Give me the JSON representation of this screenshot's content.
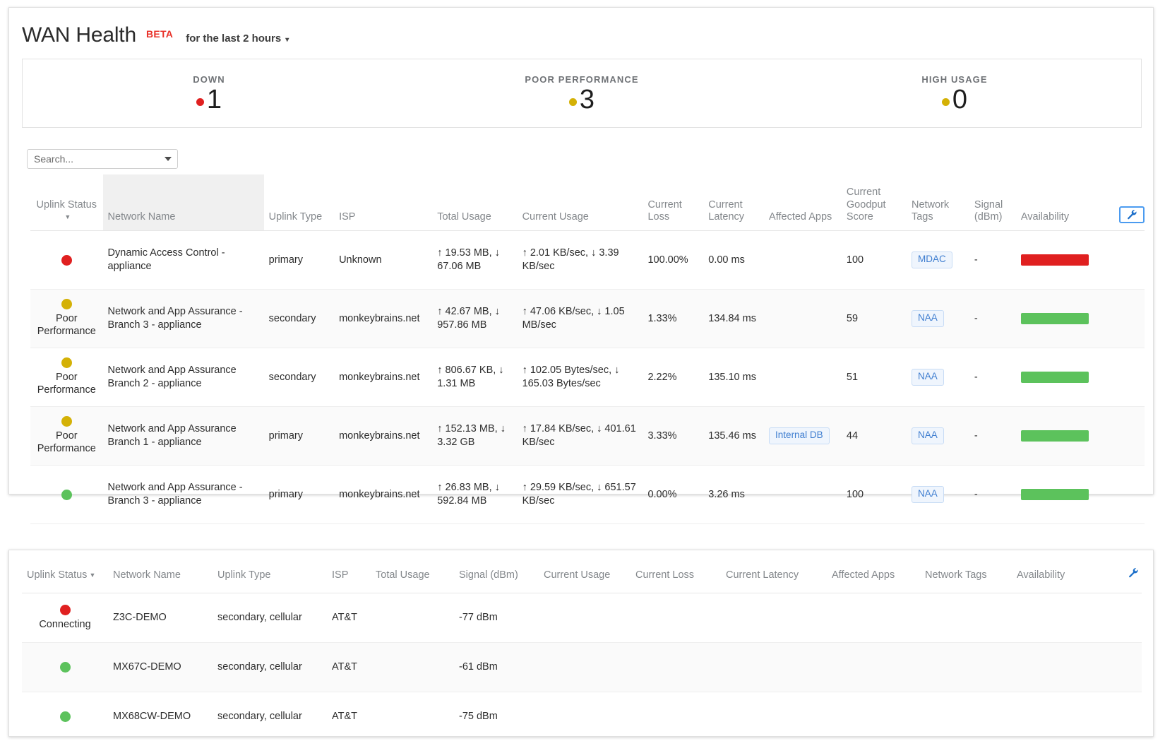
{
  "header": {
    "title": "WAN Health",
    "beta": "BETA",
    "time_range": "for the last 2 hours",
    "caret": "▾"
  },
  "summary": {
    "cards": [
      {
        "label": "DOWN",
        "value": "1",
        "color": "#e02020"
      },
      {
        "label": "POOR PERFORMANCE",
        "value": "3",
        "color": "#d4b106"
      },
      {
        "label": "HIGH USAGE",
        "value": "0",
        "color": "#d4b106"
      }
    ]
  },
  "search": {
    "placeholder": "Search...",
    "value": ""
  },
  "table1": {
    "columns": [
      "Uplink Status",
      "Network Name",
      "Uplink Type",
      "ISP",
      "Total Usage",
      "Current Usage",
      "Current Loss",
      "Current Latency",
      "Affected Apps",
      "Current Goodput Score",
      "Network Tags",
      "Signal (dBm)",
      "Availability"
    ],
    "sort_column": "Uplink Status",
    "rows": [
      {
        "status_color": "#e02020",
        "status_text": "",
        "network_name": "Dynamic Access Control - appliance",
        "uplink_type": "primary",
        "isp": "Unknown",
        "total_usage": "↑ 19.53 MB, ↓ 67.06 MB",
        "current_usage": "↑ 2.01 KB/sec, ↓ 3.39 KB/sec",
        "current_loss": "100.00%",
        "current_latency": "0.00 ms",
        "affected_apps": "",
        "goodput_score": "100",
        "network_tags": "MDAC",
        "signal": "-",
        "availability_color": "#e02020"
      },
      {
        "status_color": "#d4b106",
        "status_text": "Poor Performance",
        "network_name": "Network and App Assurance - Branch 3 - appliance",
        "uplink_type": "secondary",
        "isp": "monkeybrains.net",
        "total_usage": "↑ 42.67 MB, ↓ 957.86 MB",
        "current_usage": "↑ 47.06 KB/sec, ↓ 1.05 MB/sec",
        "current_loss": "1.33%",
        "current_latency": "134.84 ms",
        "affected_apps": "",
        "goodput_score": "59",
        "network_tags": "NAA",
        "signal": "-",
        "availability_color": "#5cc25c"
      },
      {
        "status_color": "#d4b106",
        "status_text": "Poor Performance",
        "network_name": "Network and App Assurance Branch 2 - appliance",
        "uplink_type": "secondary",
        "isp": "monkeybrains.net",
        "total_usage": "↑ 806.67 KB, ↓ 1.31 MB",
        "current_usage": "↑ 102.05 Bytes/sec, ↓ 165.03 Bytes/sec",
        "current_loss": "2.22%",
        "current_latency": "135.10 ms",
        "affected_apps": "",
        "goodput_score": "51",
        "network_tags": "NAA",
        "signal": "-",
        "availability_color": "#5cc25c"
      },
      {
        "status_color": "#d4b106",
        "status_text": "Poor Performance",
        "network_name": "Network and App Assurance Branch 1 - appliance",
        "uplink_type": "primary",
        "isp": "monkeybrains.net",
        "total_usage": "↑ 152.13 MB, ↓ 3.32 GB",
        "current_usage": "↑ 17.84 KB/sec, ↓ 401.61 KB/sec",
        "current_loss": "3.33%",
        "current_latency": "135.46 ms",
        "affected_apps": "Internal DB",
        "goodput_score": "44",
        "network_tags": "NAA",
        "signal": "-",
        "availability_color": "#5cc25c"
      },
      {
        "status_color": "#5cc25c",
        "status_text": "",
        "network_name": "Network and App Assurance - Branch 3 - appliance",
        "uplink_type": "primary",
        "isp": "monkeybrains.net",
        "total_usage": "↑ 26.83 MB, ↓ 592.84 MB",
        "current_usage": "↑ 29.59 KB/sec, ↓ 651.57 KB/sec",
        "current_loss": "0.00%",
        "current_latency": "3.26 ms",
        "affected_apps": "",
        "goodput_score": "100",
        "network_tags": "NAA",
        "signal": "-",
        "availability_color": "#5cc25c"
      }
    ]
  },
  "table2": {
    "columns": [
      "Uplink Status",
      "Network Name",
      "Uplink Type",
      "ISP",
      "Total Usage",
      "Signal (dBm)",
      "Current Usage",
      "Current Loss",
      "Current Latency",
      "Affected Apps",
      "Network Tags",
      "Availability"
    ],
    "sort_column": "Uplink Status",
    "rows": [
      {
        "status_color": "#e02020",
        "status_text": "Connecting",
        "network_name": "Z3C-DEMO",
        "uplink_type": "secondary, cellular",
        "isp": "AT&T",
        "total_usage": "",
        "signal": "-77 dBm",
        "current_usage": "",
        "current_loss": "",
        "current_latency": "",
        "affected_apps": "",
        "network_tags": "",
        "availability": ""
      },
      {
        "status_color": "#5cc25c",
        "status_text": "",
        "network_name": "MX67C-DEMO",
        "uplink_type": "secondary, cellular",
        "isp": "AT&T",
        "total_usage": "",
        "signal": "-61 dBm",
        "current_usage": "",
        "current_loss": "",
        "current_latency": "",
        "affected_apps": "",
        "network_tags": "",
        "availability": ""
      },
      {
        "status_color": "#5cc25c",
        "status_text": "",
        "network_name": "MX68CW-DEMO",
        "uplink_type": "secondary, cellular",
        "isp": "AT&T",
        "total_usage": "",
        "signal": "-75 dBm",
        "current_usage": "",
        "current_loss": "",
        "current_latency": "",
        "affected_apps": "",
        "network_tags": "",
        "availability": ""
      }
    ]
  },
  "icons": {
    "wrench": "wrench-icon",
    "settings_tooltip": "Customize columns"
  },
  "colors": {
    "red": "#e02020",
    "yellow": "#d4b106",
    "green": "#5cc25c",
    "accent_blue": "#3f7ed0"
  }
}
